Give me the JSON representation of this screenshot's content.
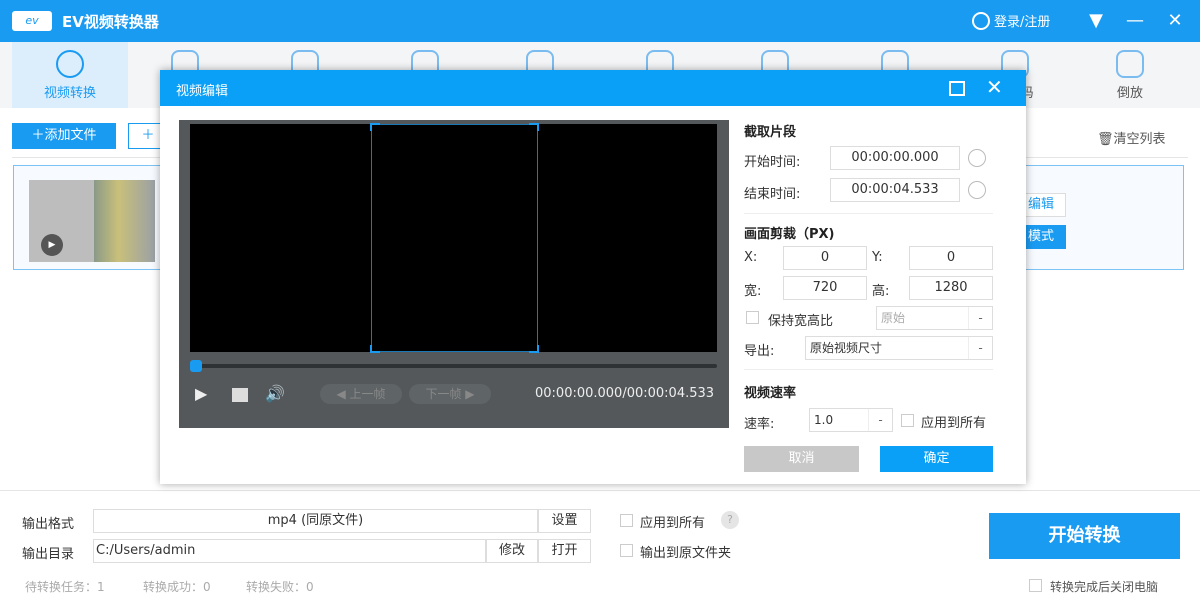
{
  "app": {
    "title": "EV视频转换器",
    "logo_text": "ev",
    "login": "登录/注册"
  },
  "toolbar": {
    "items": [
      {
        "label": "视频转换",
        "icon": "convert-icon",
        "active": true
      },
      {
        "label": "",
        "icon": "download-icon"
      },
      {
        "label": "",
        "icon": "video-icon"
      },
      {
        "label": "",
        "icon": "copy-icon"
      },
      {
        "label": "",
        "icon": "crop-icon"
      },
      {
        "label": "",
        "icon": "stamp-icon"
      },
      {
        "label": "",
        "icon": "drop-icon"
      },
      {
        "label": "",
        "icon": "file-icon"
      },
      {
        "label": "码",
        "icon": "face-icon"
      },
      {
        "label": "倒放",
        "icon": "reverse-icon"
      }
    ]
  },
  "actions": {
    "add_file": "添加文件",
    "add_second": "",
    "clear_list": "清空列表"
  },
  "file_card": {
    "edit": "编辑",
    "mode": "模式"
  },
  "dialog": {
    "title": "视频编辑",
    "player": {
      "prev_frame": "上一帧",
      "next_frame": "下一帧",
      "timecode": "00:00:00.000/00:00:04.533",
      "progress": 0
    },
    "clip": {
      "heading": "截取片段",
      "start_label": "开始时间:",
      "start": "00:00:00.000",
      "end_label": "结束时间:",
      "end": "00:00:04.533"
    },
    "crop": {
      "heading": "画面剪裁（PX)",
      "x_label": "X:",
      "x": "0",
      "y_label": "Y:",
      "y": "0",
      "w_label": "宽:",
      "w": "720",
      "h_label": "高:",
      "h": "1280",
      "keep_ratio": "保持宽高比",
      "ratio": "原始",
      "export_label": "导出:",
      "export": "原始视频尺寸"
    },
    "speed": {
      "heading": "视频速率",
      "label": "速率:",
      "value": "1.0",
      "apply_all": "应用到所有"
    },
    "cancel": "取消",
    "ok": "确定"
  },
  "bottom": {
    "format_label": "输出格式",
    "format": "mp4 (同原文件)",
    "settings": "设置",
    "apply_all": "应用到所有",
    "help": "?",
    "dir_label": "输出目录",
    "dir": "C:/Users/admin",
    "modify": "修改",
    "open": "打开",
    "to_source": "输出到原文件夹",
    "start": "开始转换",
    "pending": "待转换任务：1",
    "success": "转换成功：0",
    "failed": "转换失败：0",
    "shutdown": "转换完成后关闭电脑"
  },
  "colors": {
    "accent": "#1a9bf2",
    "dialog_header": "#0aa0f7",
    "player_bg": "#54585b"
  }
}
